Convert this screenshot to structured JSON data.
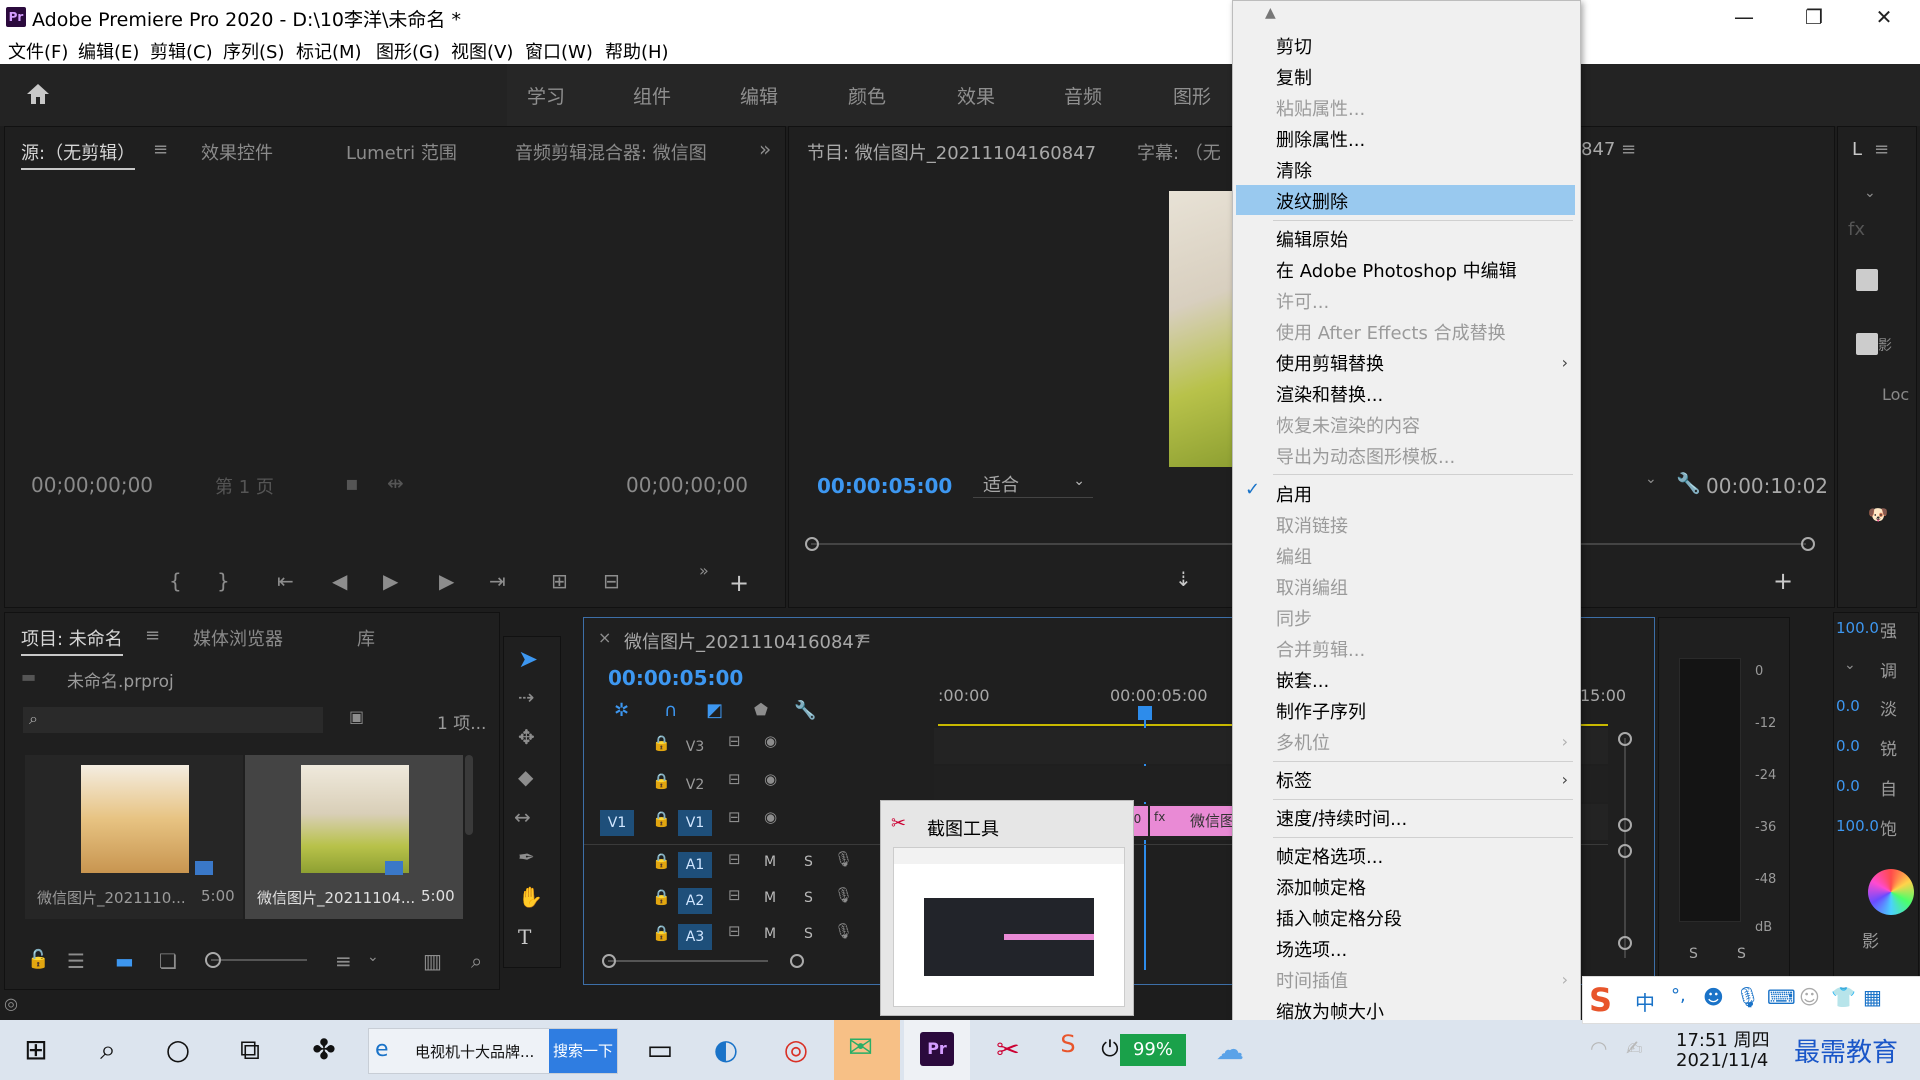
{
  "window": {
    "logo": "Pr",
    "title": "Adobe Premiere Pro 2020 - D:\\10李洋\\未命名 *",
    "min": "—",
    "max": "❐",
    "close": "✕"
  },
  "menu": [
    "文件(F)",
    "编辑(E)",
    "剪辑(C)",
    "序列(S)",
    "标记(M)",
    "图形(G)",
    "视图(V)",
    "窗口(W)",
    "帮助(H)"
  ],
  "workspaces": [
    "学习",
    "组件",
    "编辑",
    "颜色",
    "效果",
    "音频",
    "图形"
  ],
  "source_panel": {
    "tabs": [
      "源:（无剪辑）",
      "效果控件",
      "Lumetri 范围",
      "音频剪辑混合器: 微信图"
    ],
    "tc_left": "00;00;00;00",
    "page": "第 1 页",
    "tc_right": "00;00;00;00"
  },
  "program_panel": {
    "tabs": [
      "节目: 微信图片_20211104160847",
      "字幕: （无"
    ],
    "tab_suffix": "847",
    "tc_left": "00:00:05:00",
    "fit": "适合",
    "tc_right": "00:00:10:02"
  },
  "project_panel": {
    "tabs": [
      "项目: 未命名",
      "媒体浏览器",
      "库"
    ],
    "file": "未命名.prproj",
    "count": "1 项...",
    "items": [
      {
        "name": "微信图片_2021110...",
        "duration": "5:00"
      },
      {
        "name": "微信图片_20211104...",
        "duration": "5:00"
      }
    ]
  },
  "timeline": {
    "title": "微信图片_20211104160847",
    "timecode": "00:00:05:00",
    "ruler": [
      ":00:00",
      "00:00:05:00",
      "15:00"
    ],
    "video_tracks": [
      "V3",
      "V2",
      "V1"
    ],
    "audio_tracks": [
      "A1",
      "A2",
      "A3"
    ],
    "source_patch": "V1",
    "m": "M",
    "s": "S",
    "clip_label": "微信图",
    "clip_num": "60"
  },
  "snip_tool": {
    "title": "截图工具"
  },
  "right_panel": {
    "labels": [
      "L",
      "Loc",
      "100.0",
      "强",
      "调",
      "淡",
      "锐",
      "自",
      "饱",
      "影",
      "0.0",
      "0.0",
      "0.0",
      "100.0"
    ],
    "fx": "fx",
    "label_shadow": "影",
    "meter_ticks": [
      "0",
      "-12",
      "-24",
      "-36",
      "-48",
      "dB"
    ],
    "solo": "S"
  },
  "context_menu": [
    {
      "label": "剪切",
      "enabled": true
    },
    {
      "label": "复制",
      "enabled": true
    },
    {
      "label": "粘贴属性...",
      "enabled": false
    },
    {
      "label": "删除属性...",
      "enabled": true
    },
    {
      "label": "清除",
      "enabled": true
    },
    {
      "label": "波纹删除",
      "enabled": true,
      "highlighted": true
    },
    {
      "label": "编辑原始",
      "enabled": true
    },
    {
      "label": "在 Adobe Photoshop 中编辑",
      "enabled": true
    },
    {
      "label": "许可...",
      "enabled": false
    },
    {
      "label": "使用 After Effects 合成替换",
      "enabled": false
    },
    {
      "label": "使用剪辑替换",
      "enabled": true,
      "submenu": true
    },
    {
      "label": "渲染和替换...",
      "enabled": true
    },
    {
      "label": "恢复未渲染的内容",
      "enabled": false
    },
    {
      "label": "导出为动态图形模板...",
      "enabled": false
    },
    {
      "label": "启用",
      "enabled": true,
      "checked": true
    },
    {
      "label": "取消链接",
      "enabled": false
    },
    {
      "label": "编组",
      "enabled": false
    },
    {
      "label": "取消编组",
      "enabled": false
    },
    {
      "label": "同步",
      "enabled": false
    },
    {
      "label": "合并剪辑...",
      "enabled": false
    },
    {
      "label": "嵌套...",
      "enabled": true
    },
    {
      "label": "制作子序列",
      "enabled": true
    },
    {
      "label": "多机位",
      "enabled": false,
      "submenu": true
    },
    {
      "label": "标签",
      "enabled": true,
      "submenu": true
    },
    {
      "label": "速度/持续时间...",
      "enabled": true
    },
    {
      "label": "帧定格选项...",
      "enabled": true
    },
    {
      "label": "添加帧定格",
      "enabled": true
    },
    {
      "label": "插入帧定格分段",
      "enabled": true
    },
    {
      "label": "场选项...",
      "enabled": true
    },
    {
      "label": "时间插值",
      "enabled": false,
      "submenu": true
    },
    {
      "label": "缩放为帧大小",
      "enabled": true
    }
  ],
  "taskbar": {
    "search_text": "电视机十大品牌...",
    "search_btn": "搜索一下",
    "battery": "99%",
    "ime": "中",
    "ime_punct": "°,",
    "time": "17:51 周四",
    "date": "2021/11/4",
    "watermark": "最需教育"
  },
  "colors": {
    "accent": "#3d97f0",
    "highlight": "#99c9ef",
    "clip": "#e98ad5",
    "playhead": "#2d8ceb"
  }
}
